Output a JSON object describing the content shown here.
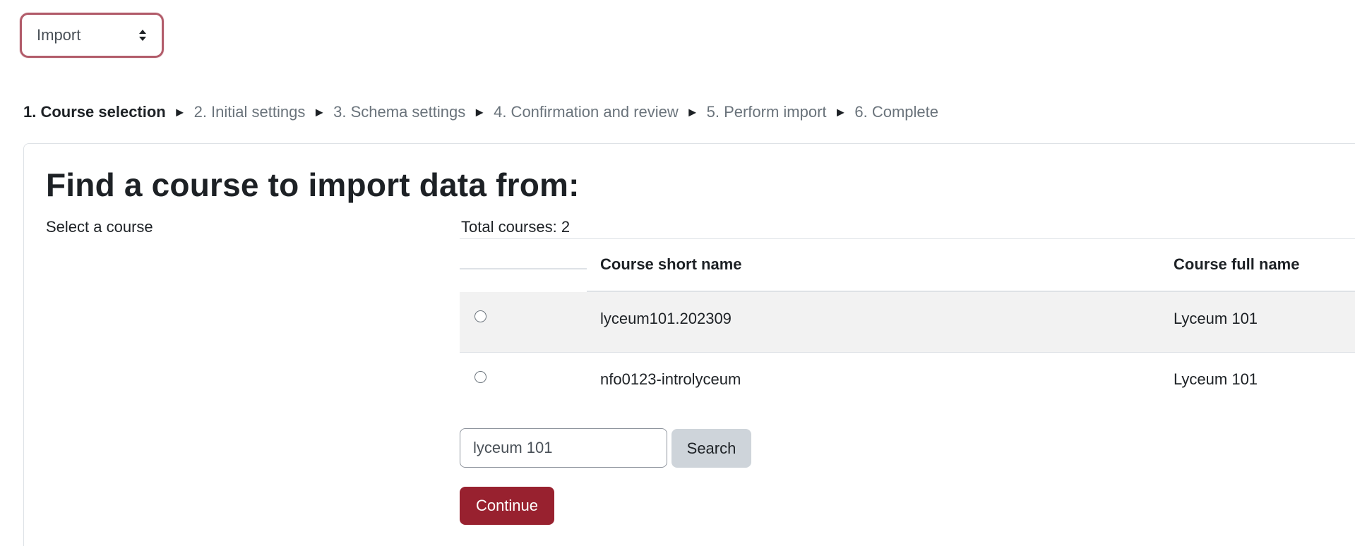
{
  "nav_select": {
    "selected": "Import"
  },
  "steps": [
    {
      "label": "1. Course selection",
      "current": true
    },
    {
      "label": "2. Initial settings"
    },
    {
      "label": "3. Schema settings"
    },
    {
      "label": "4. Confirmation and review"
    },
    {
      "label": "5. Perform import"
    },
    {
      "label": "6. Complete"
    }
  ],
  "step_separator": "►",
  "card": {
    "heading": "Find a course to import data from:",
    "select_label": "Select a course",
    "total_courses": "Total courses: 2"
  },
  "table": {
    "columns": [
      "Course short name",
      "Course full name"
    ],
    "rows": [
      {
        "short_name": "lyceum101.202309",
        "full_name": "Lyceum 101"
      },
      {
        "short_name": "nfo0123-introlyceum",
        "full_name": "Lyceum 101"
      }
    ]
  },
  "search": {
    "value": "lyceum 101",
    "button_label": "Search"
  },
  "continue_label": "Continue",
  "colors": {
    "accent": "#98212f",
    "focus_ring": "#b25c6a",
    "row_stripe": "#f2f2f2",
    "secondary_button": "#ced4da"
  },
  "icons": {
    "select_arrows": "sort-arrows-icon"
  }
}
